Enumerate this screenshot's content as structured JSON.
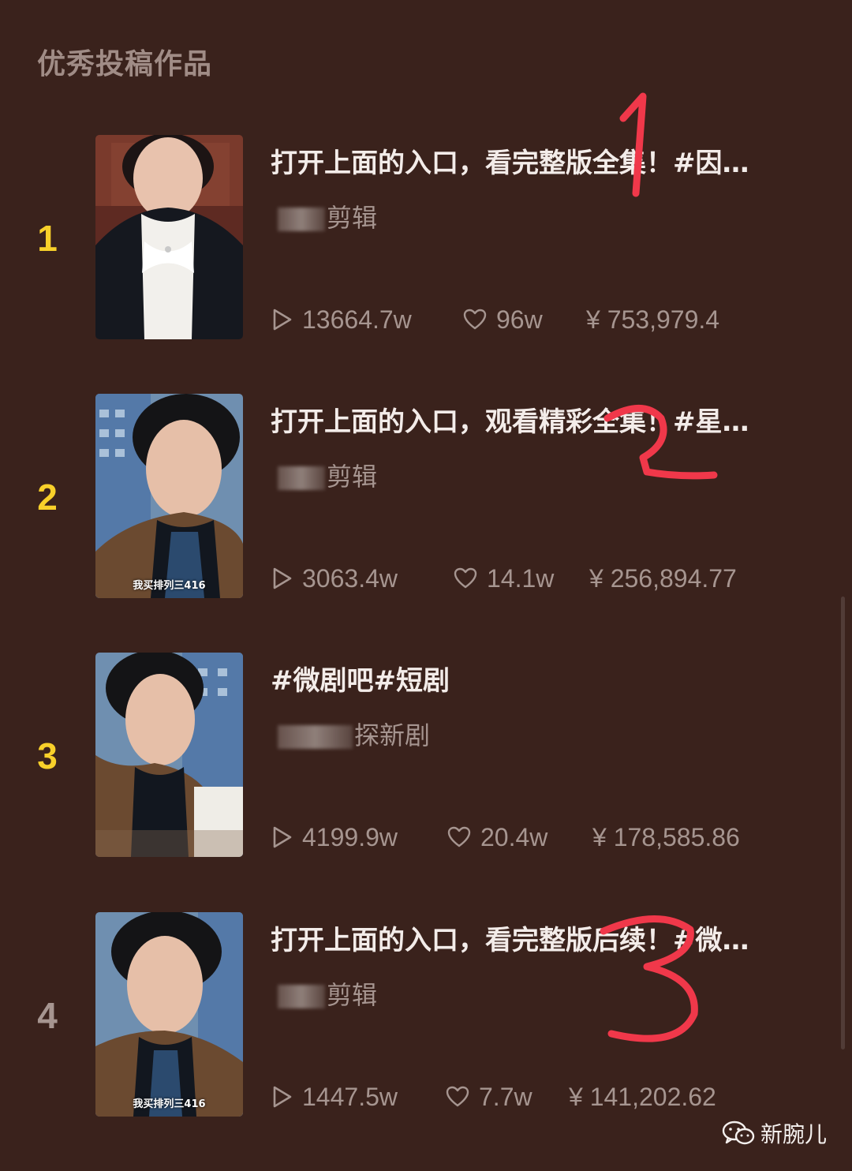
{
  "section": {
    "title": "优秀投稿作品"
  },
  "items": [
    {
      "rank": "1",
      "rank_color": "#f8d02a",
      "title": "打开上面的入口，看完整版全集！#因…",
      "author": "剪辑",
      "plays": "13664.7w",
      "likes": "96w",
      "income": "¥ 753,979.4",
      "thumb_caption": ""
    },
    {
      "rank": "2",
      "rank_color": "#f8d02a",
      "title": "打开上面的入口，观看精彩全集！#星…",
      "author": "剪辑",
      "plays": "3063.4w",
      "likes": "14.1w",
      "income": "¥ 256,894.77",
      "thumb_caption": "我买排列三416"
    },
    {
      "rank": "3",
      "rank_color": "#f8d02a",
      "title": "#微剧吧#短剧",
      "author": "探新剧",
      "plays": "4199.9w",
      "likes": "20.4w",
      "income": "¥ 178,585.86",
      "thumb_caption": ""
    },
    {
      "rank": "4",
      "rank_color": "#a69590",
      "title": "打开上面的入口，看完整版后续！#微…",
      "author": "剪辑",
      "plays": "1447.5w",
      "likes": "7.7w",
      "income": "¥ 141,202.62",
      "thumb_caption": "我买排列三416"
    }
  ],
  "annotations": [
    "1",
    "2",
    "3"
  ],
  "watermark": {
    "text": "新腕儿",
    "icon": "wechat-icon"
  },
  "icons": {
    "play": "play-icon",
    "like": "heart-icon"
  }
}
